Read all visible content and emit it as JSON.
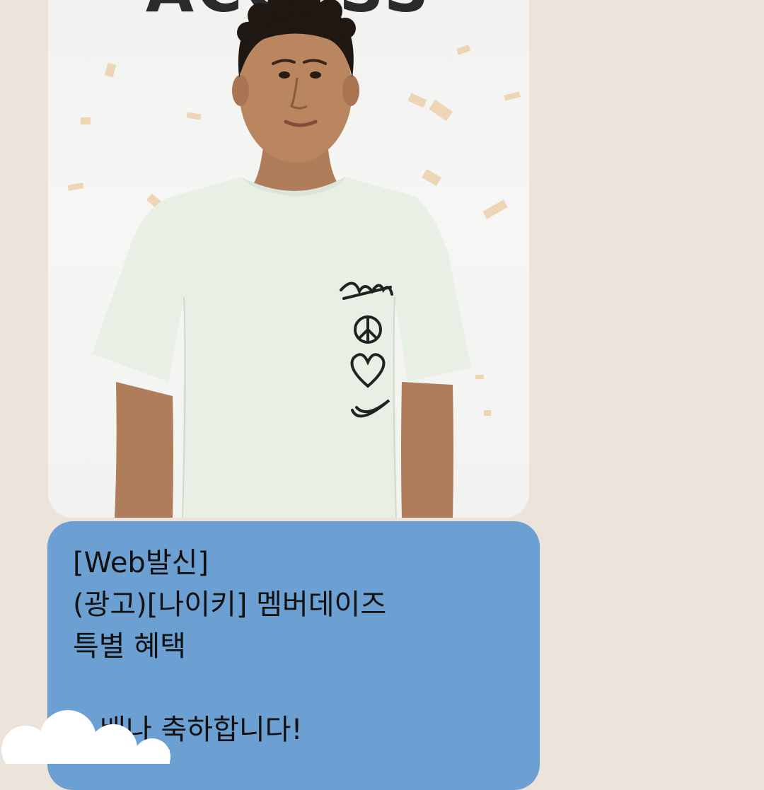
{
  "promo_image": {
    "headline": "ACCESS",
    "shirt_graphics": [
      "Stüssy script logo",
      "peace sign",
      "heart",
      "swoosh"
    ]
  },
  "message": {
    "lines": [
      "[Web발신]",
      "(광고)[나이키] 멤버데이즈",
      "특별 혜택",
      "",
      "...배나 축하합니다!"
    ]
  },
  "colors": {
    "background": "#ece3da",
    "message_bubble": "#6c9fd2",
    "message_text": "#111111"
  }
}
